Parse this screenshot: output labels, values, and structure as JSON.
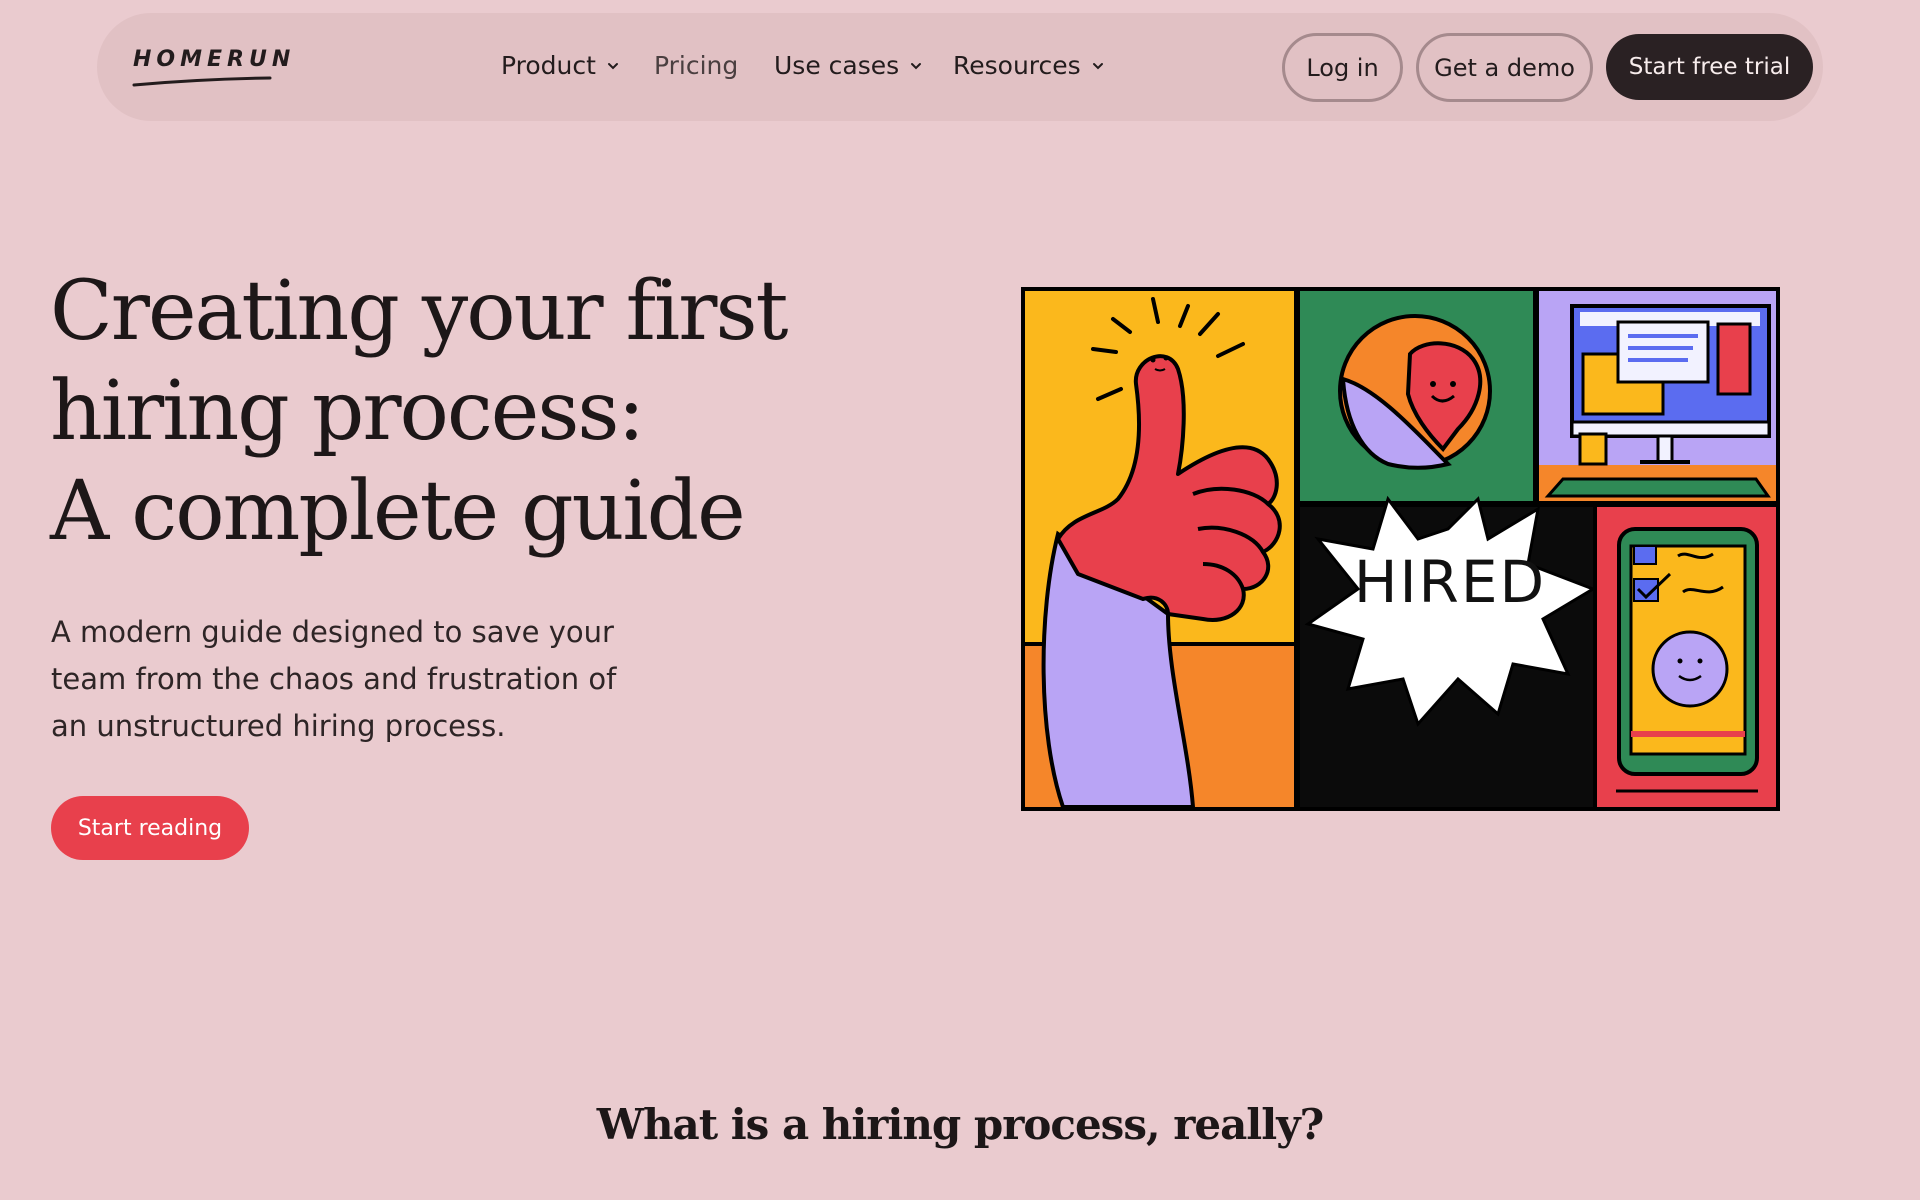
{
  "brand": {
    "name": "HOMERUN"
  },
  "nav": {
    "items": [
      {
        "label": "Product",
        "has_dropdown": true
      },
      {
        "label": "Pricing",
        "has_dropdown": false
      },
      {
        "label": "Use cases",
        "has_dropdown": true
      },
      {
        "label": "Resources",
        "has_dropdown": true
      }
    ],
    "login_label": "Log in",
    "demo_label": "Get a demo",
    "trial_label": "Start free trial"
  },
  "hero": {
    "title_lines": [
      "Creating your first",
      "hiring process:",
      "A complete guide"
    ],
    "subtitle_lines": [
      "A modern guide designed to save your",
      "team from the chaos and frustration of",
      "an unstructured hiring process."
    ],
    "cta_label": "Start reading"
  },
  "illustration": {
    "badge_text": "HIRED",
    "icons": [
      "thumbs-up-icon",
      "smiling-face-icon",
      "computer-monitor-icon",
      "phone-checklist-icon"
    ]
  },
  "section": {
    "heading": "What is a hiring process, really?"
  },
  "colors": {
    "background": "#eacbcf",
    "nav_background": "#e1c1c4",
    "primary_dark": "#2a2123",
    "accent_red": "#e8404c"
  }
}
